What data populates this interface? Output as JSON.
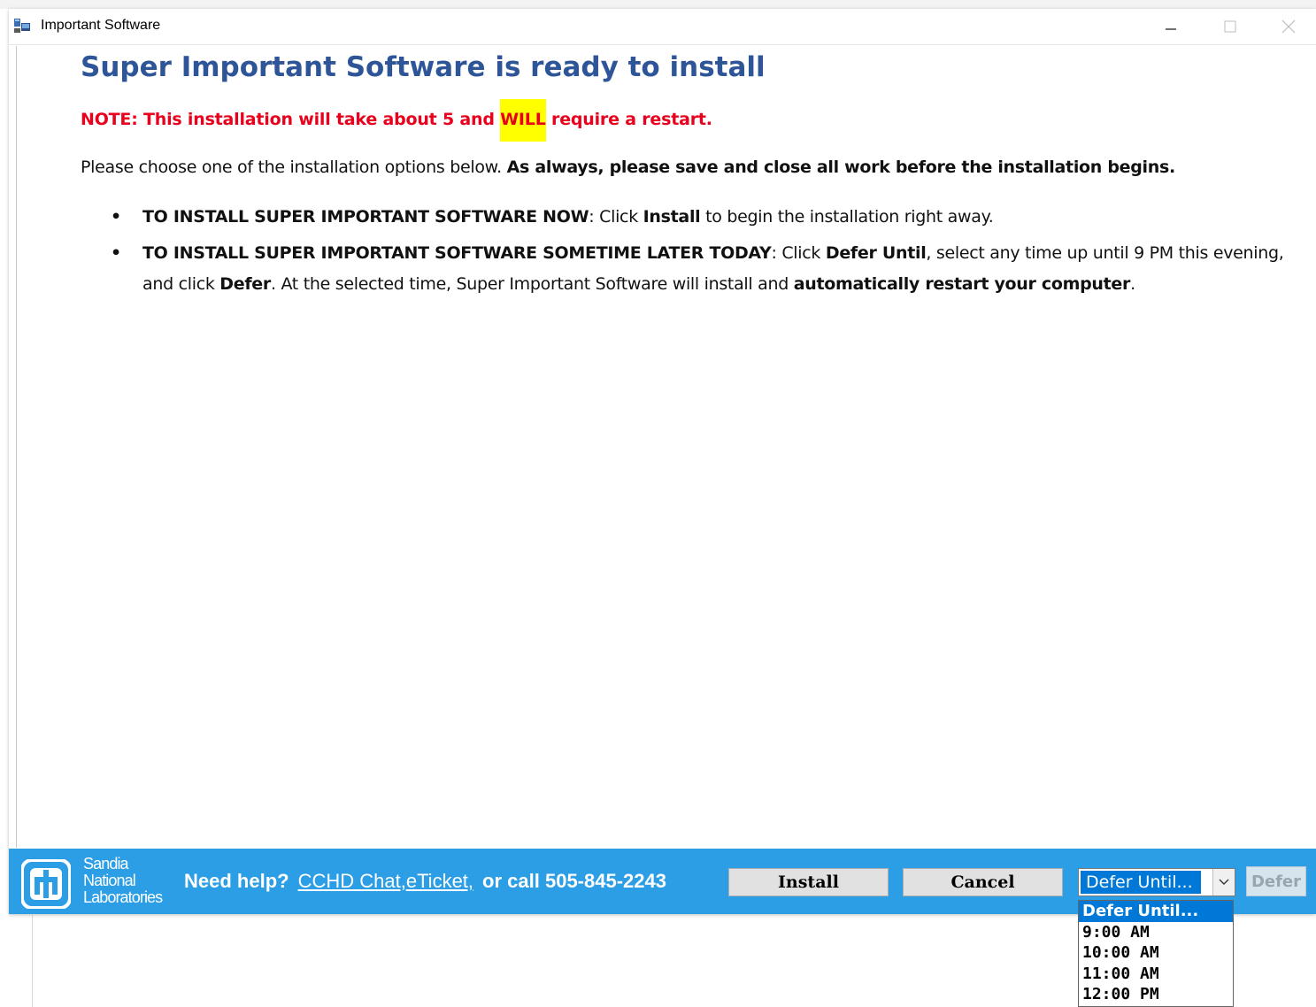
{
  "window": {
    "title": "Important Software",
    "icon": "installer-icon",
    "controls": {
      "minimize": "minimize-icon",
      "maximize": "maximize-icon",
      "close": "close-icon"
    }
  },
  "content": {
    "heading": "Super Important Software is ready to install",
    "note_before": "NOTE: This installation will take about 5 and ",
    "note_highlight": "WILL",
    "note_after": " require a restart.",
    "intro_plain": "Please choose one of the installation options below. ",
    "intro_bold": "As always, please save and close all work before the installation begins.",
    "options": [
      {
        "bullet": "•",
        "lead": "TO INSTALL SUPER IMPORTANT SOFTWARE NOW",
        "text1": ": Click ",
        "bold1": "Install",
        "text2": " to begin the installation right away."
      },
      {
        "bullet": "•",
        "lead": "TO INSTALL SUPER IMPORTANT SOFTWARE SOMETIME LATER TODAY",
        "text1": ": Click ",
        "bold1": "Defer Until",
        "text2": ", select any time up until 9 PM this evening, and click ",
        "bold2": "Defer",
        "text3": ". At the selected time, Super Important Software will install and ",
        "bold3": "automatically restart your computer",
        "text4": "."
      }
    ]
  },
  "footer": {
    "logo_lines": [
      "Sandia",
      "National",
      "Laboratories"
    ],
    "help_prefix": "Need help?",
    "help_link1": "CCHD Chat,",
    "help_link2": "eTicket,",
    "help_suffix": "or call 505-845-2243",
    "install_label": "Install",
    "cancel_label": "Cancel",
    "defer_select_value": "Defer Until...",
    "defer_label": "Defer",
    "colors": {
      "bar": "#2c9ee6",
      "heading": "#2e5597",
      "note": "#e8001c",
      "highlight": "#ffff00",
      "selection": "#0078d7"
    }
  },
  "dropdown": {
    "options": [
      "Defer Until...",
      "9:00 AM",
      "10:00 AM",
      "11:00 AM",
      "12:00 PM"
    ],
    "selected_index": 0
  }
}
